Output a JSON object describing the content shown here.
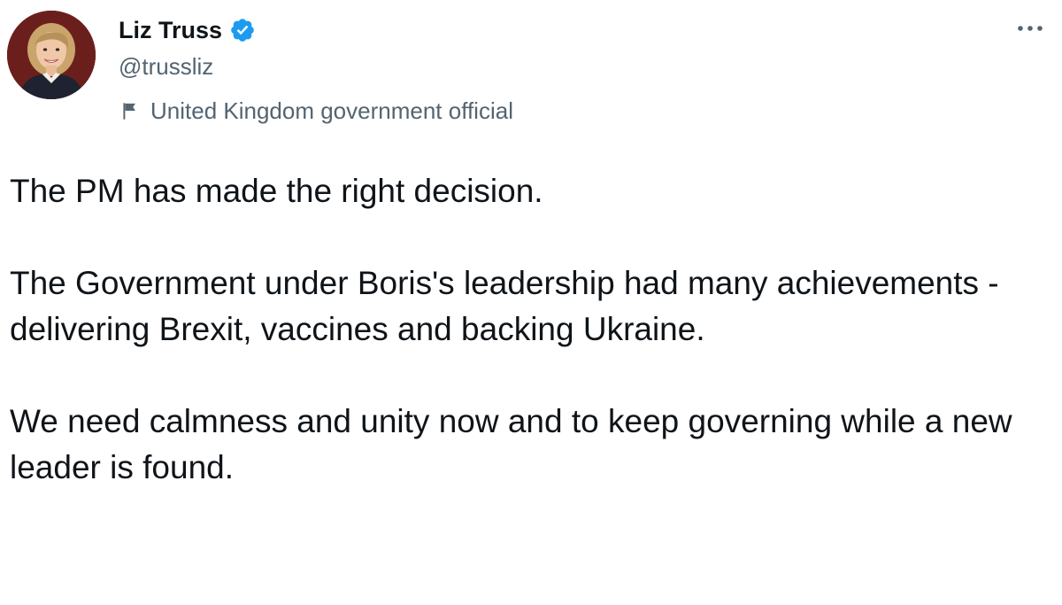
{
  "tweet": {
    "author": {
      "name": "Liz Truss",
      "handle": "@trussliz",
      "verified": true,
      "account_label": "United Kingdom government official",
      "avatar_icon": "profile-photo"
    },
    "more_icon": "more-dots-icon",
    "paragraphs": [
      "The PM has made the right decision.",
      "The Government under Boris's leadership had many achievements - delivering Brexit, vaccines and backing Ukraine.",
      "We need calmness and unity now and to keep governing while a new leader is found."
    ]
  },
  "colors": {
    "text": "#0f1419",
    "secondary": "#536471",
    "verified_blue": "#1d9bf0",
    "background": "#ffffff"
  }
}
